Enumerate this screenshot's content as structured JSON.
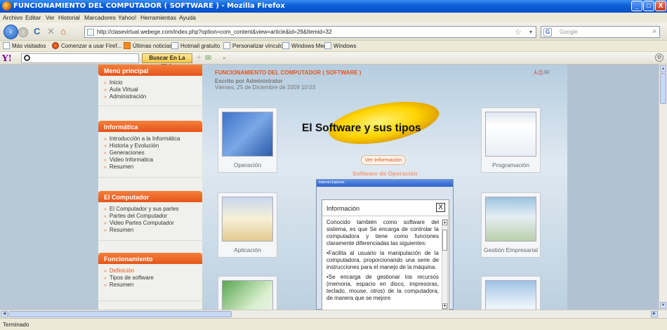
{
  "window": {
    "title": "FUNCIONAMIENTO DEL COMPUTADOR ( SOFTWARE ) - Mozilla Firefox",
    "minimize": "_",
    "maximize": "□",
    "close": "X"
  },
  "menu": [
    "Archivo",
    "Editar",
    "Ver",
    "Historial",
    "Marcadores",
    "Yahoo!",
    "Herramientas",
    "Ayuda"
  ],
  "nav": {
    "back": "‹",
    "forward": "›",
    "reload": "C",
    "stop": "✕",
    "home": "⌂",
    "url": "http://clasevirtual.webege.com/index.php?option=com_content&view=article&id=29&Itemid=32",
    "search_placeholder": "Google",
    "search_engine_icon": "G"
  },
  "bookmarks": [
    "Más visitados",
    "Comenzar a usar Firef...",
    "Últimas noticias",
    "Hotmail gratuito",
    "Personalizar vínculos",
    "Windows Media",
    "Windows"
  ],
  "yahoo_toolbar": {
    "logo": "Y!",
    "button": "Buscar En La Web"
  },
  "sidebar": {
    "modules": [
      {
        "title": "Menú principal",
        "items": [
          "Inicio",
          "Aula Virtual",
          "Administración"
        ]
      },
      {
        "title": "Informática",
        "items": [
          "Introducción a la Informática",
          "Historia y Evolución",
          "Generaciones",
          "Video Informatica",
          "Resumen"
        ]
      },
      {
        "title": "El Computador",
        "items": [
          "El Computador y sus partes",
          "Partes del Computador",
          "Video Partes Computador",
          "Resumen"
        ]
      },
      {
        "title": "Funcionamiento",
        "items": [
          "Definición",
          "Tipos de software",
          "Resumen"
        ],
        "active_index": 0
      }
    ]
  },
  "article": {
    "title": "FUNCIONAMIENTO DEL COMPUTADOR ( SOFTWARE )",
    "author": "Escrito por Administrator",
    "date": "Viernes, 25 de Diciembre de 2009 10:03",
    "banner": "El Software y sus tipos",
    "ver_info": "Ver Información",
    "software_operacion": "Software de Operación",
    "thumbnails": [
      "Operación",
      "Programación",
      "Aplicación",
      "Gestión Empresarial"
    ]
  },
  "popup": {
    "titlebar": "Internet Explorer",
    "heading": "Información",
    "close": "X",
    "paragraphs": [
      "Conocido también como software del sistema, es que Se encarga de controlar la computadora y tiene como funciones claramente diferenciadas las siguientes:",
      "•Facilita al usuario la manipulación de la computadora, proporcionando una serie de instrucciones para el manejo de la máquina.",
      "•Se encarga de gestionar los recursos (memoria, espacio en disco, impresoras, teclado, mouse, otros) de la computadora, de manera que se mejore"
    ]
  },
  "status": "Terminado",
  "colors": {
    "accent_orange": "#e3561c",
    "titlebar_blue": "#0a5fd8"
  }
}
